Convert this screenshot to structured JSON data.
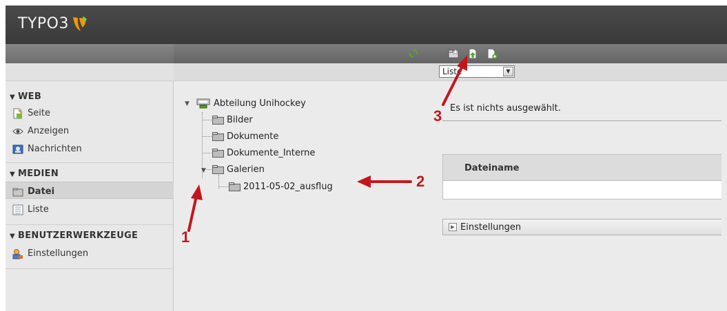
{
  "app": {
    "logo_text": "TYPO3",
    "colors": {
      "accent": "#f49700",
      "green": "#8fc13e",
      "annotation": "#c3161c"
    }
  },
  "toolbar": {
    "icons": [
      "refresh-icon",
      "new-folder-icon",
      "upload-file-icon",
      "new-file-icon"
    ]
  },
  "view_select": {
    "value": "Liste"
  },
  "module_menu": {
    "groups": [
      {
        "label": "WEB",
        "items": [
          {
            "label": "Seite",
            "icon": "page-icon"
          },
          {
            "label": "Anzeigen",
            "icon": "eye-icon"
          },
          {
            "label": "Nachrichten",
            "icon": "news-icon"
          }
        ]
      },
      {
        "label": "MEDIEN",
        "items": [
          {
            "label": "Datei",
            "icon": "folder-icon",
            "active": true
          },
          {
            "label": "Liste",
            "icon": "list-icon"
          }
        ]
      },
      {
        "label": "BENUTZERWERKZEUGE",
        "items": [
          {
            "label": "Einstellungen",
            "icon": "user-settings-icon"
          }
        ]
      }
    ]
  },
  "tree": {
    "root": "Abteilung Unihockey",
    "nodes": [
      "Bilder",
      "Dokumente",
      "Dokumente_Interne",
      "Galerien"
    ],
    "child": "2011-05-02_ausflug"
  },
  "content": {
    "nothing_selected": "Es ist nichts ausgewählt.",
    "table_header": "Dateiname",
    "settings_label": "Einstellungen"
  },
  "annotations": {
    "one": "1",
    "two": "2",
    "three": "3"
  }
}
